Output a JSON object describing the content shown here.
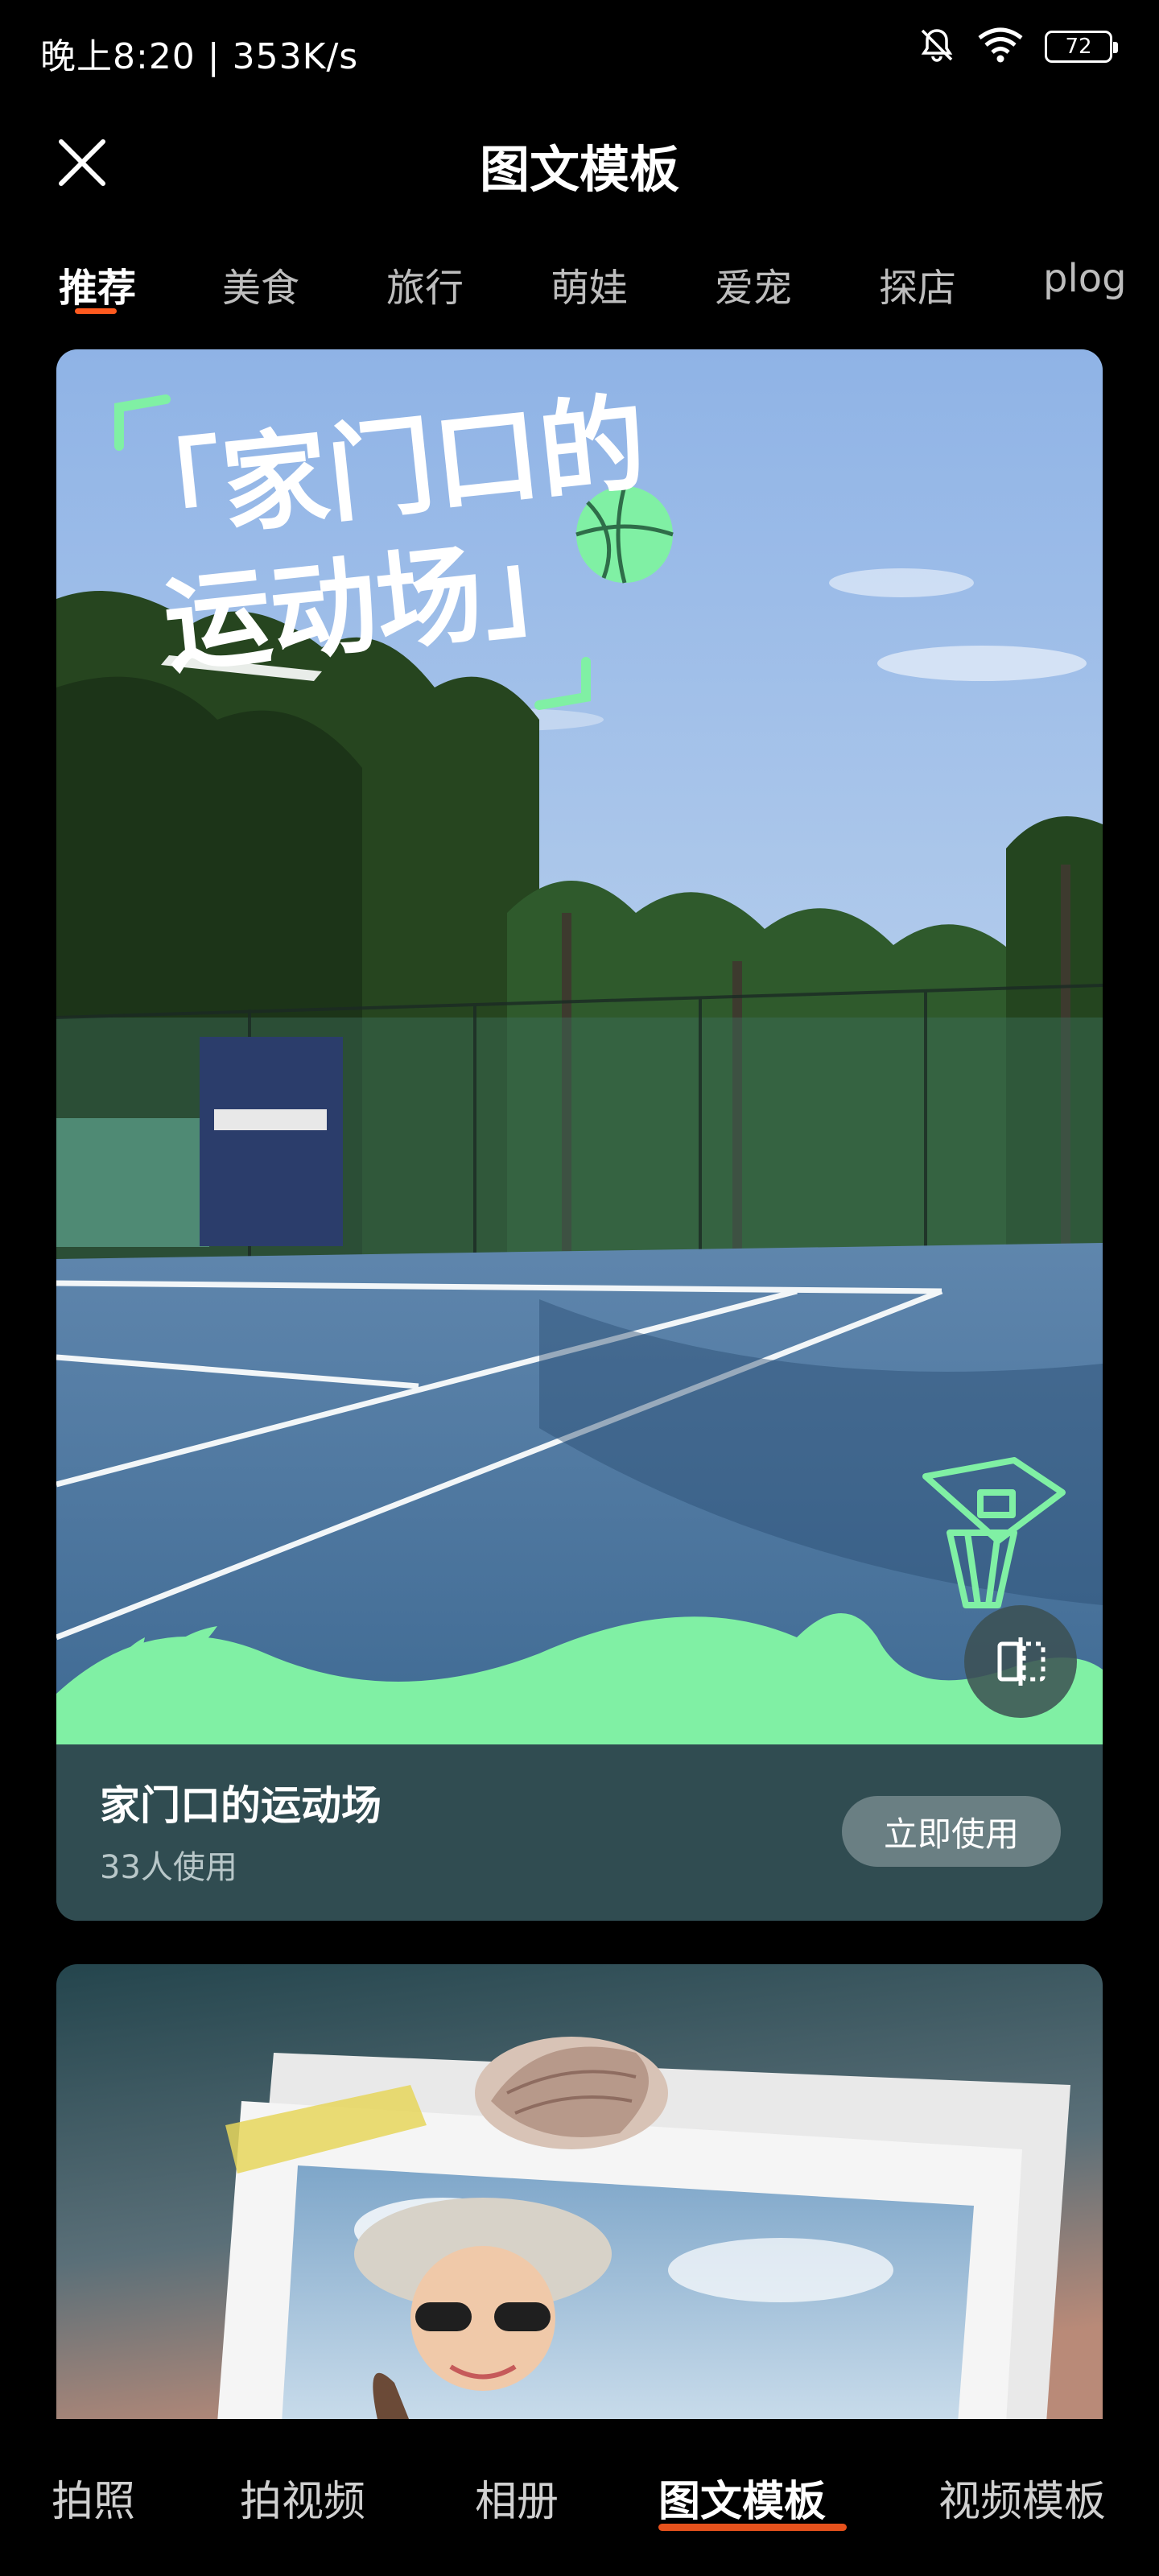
{
  "status_bar": {
    "time": "晚上8:20 | 353K/s",
    "battery": "72",
    "icons": [
      "mute-bell-icon",
      "wifi-icon",
      "battery-icon"
    ]
  },
  "header": {
    "title": "图文模板",
    "close_icon": "close-icon"
  },
  "categories": [
    "推荐",
    "美食",
    "旅行",
    "萌娃",
    "爱宠",
    "探店",
    "plog"
  ],
  "active_category": "推荐",
  "card1": {
    "overlay_title_line1": "「家门口的",
    "overlay_title_line2": "运动场」",
    "name": "家门口的运动场",
    "usage": "33人使用",
    "use_button": "立即使用",
    "switch_icon": "flip-icon"
  },
  "bottom_nav": [
    "拍照",
    "拍视频",
    "相册",
    "图文模板",
    "视频模板"
  ],
  "active_nav": "图文模板",
  "colors": {
    "accent": "#ff5a1f",
    "card_info_bg": "#304c51",
    "mint": "#7ef2a6"
  }
}
